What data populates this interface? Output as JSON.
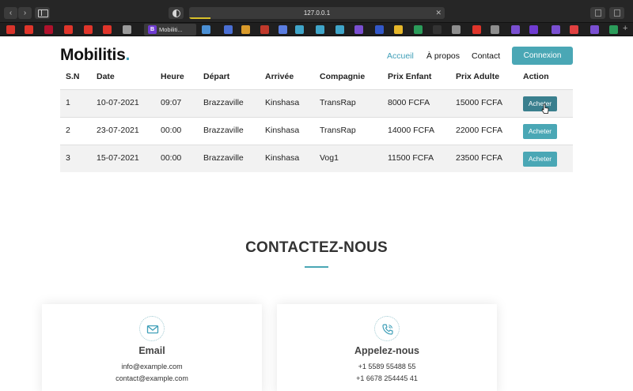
{
  "browser": {
    "url": "127.0.0.1",
    "active_tab_title": "Mobiliti...",
    "active_tab_badge": "B",
    "bookmark_colors": [
      "#d9342b",
      "#e0352b",
      "#b0122c",
      "#e0352b",
      "#e0352b",
      "#e0352b",
      "#9b9b9b",
      "#4a8fd4",
      "#4a6fd4",
      "#d99a2a",
      "#c0392b",
      "#5a7de0",
      "#3fa5c9",
      "#3fa5c9",
      "#3fa5c9",
      "#7a4fd1",
      "#3358c9",
      "#e6b72a",
      "#2b9c5a",
      "#333333",
      "#8e8e8e",
      "#e0352b",
      "#8e8e8e",
      "#7a4fd1",
      "#6f3bd1",
      "#7a4fd1",
      "#e04040",
      "#7a4fd1",
      "#2b9c5a"
    ]
  },
  "header": {
    "logo_text": "Mobilitis",
    "logo_dot": ".",
    "nav": [
      {
        "label": "Accueil",
        "active": true
      },
      {
        "label": "À propos",
        "active": false
      },
      {
        "label": "Contact",
        "active": false
      }
    ],
    "login_label": "Connexion",
    "accent_color": "#4aa7b5"
  },
  "table": {
    "columns": [
      "S.N",
      "Date",
      "Heure",
      "Départ",
      "Arrivée",
      "Compagnie",
      "Prix Enfant",
      "Prix Adulte",
      "Action"
    ],
    "rows": [
      {
        "sn": "1",
        "date": "10-07-2021",
        "time": "09:07",
        "from": "Brazzaville",
        "to": "Kinshasa",
        "company": "TransRap",
        "child": "8000 FCFA",
        "adult": "15000 FCFA",
        "action": "Acheter"
      },
      {
        "sn": "2",
        "date": "23-07-2021",
        "time": "00:00",
        "from": "Brazzaville",
        "to": "Kinshasa",
        "company": "TransRap",
        "child": "14000 FCFA",
        "adult": "22000 FCFA",
        "action": "Acheter"
      },
      {
        "sn": "3",
        "date": "15-07-2021",
        "time": "00:00",
        "from": "Brazzaville",
        "to": "Kinshasa",
        "company": "Vog1",
        "child": "11500 FCFA",
        "adult": "23500 FCFA",
        "action": "Acheter"
      }
    ]
  },
  "contact": {
    "title": "CONTACTEZ-NOUS",
    "cards": [
      {
        "title": "Email",
        "icon": "envelope-icon",
        "lines": [
          "info@example.com",
          "contact@example.com"
        ]
      },
      {
        "title": "Appelez-nous",
        "icon": "phone-icon",
        "lines": [
          "+1 5589 55488 55",
          "+1 6678 254445 41"
        ]
      }
    ]
  }
}
